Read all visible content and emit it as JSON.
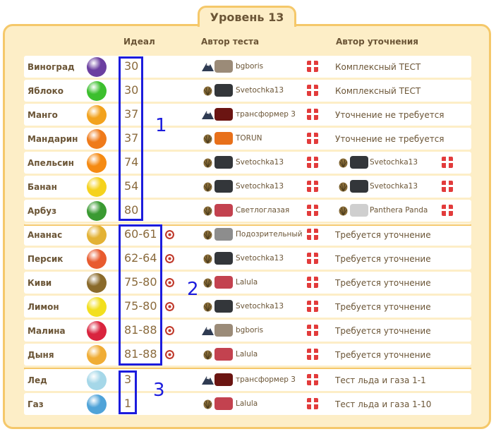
{
  "title": "Уровень 13",
  "headers": {
    "ideal": "Идеал",
    "test_author": "Автор теста",
    "clarify_author": "Автор уточнения"
  },
  "rows": [
    {
      "name": "Виноград",
      "ideal": "30",
      "target": false,
      "author": "bgboris",
      "clar": "Комплексный ТЕСТ",
      "clar_author": "",
      "fruit_color": "#6b3fa0",
      "rank": "mountain",
      "clan": "#9b8b78"
    },
    {
      "name": "Яблоко",
      "ideal": "30",
      "target": false,
      "author": "Svetochka13",
      "clar": "Комплексный ТЕСТ",
      "clar_author": "",
      "fruit_color": "#3cbf2e",
      "rank": "shell",
      "clan": "#33363a"
    },
    {
      "name": "Манго",
      "ideal": "37",
      "target": false,
      "author": "трансформер 3",
      "clar": "Уточнение не требуется",
      "clar_author": "",
      "fruit_color": "#f2a21d",
      "rank": "mountain",
      "clan": "#6b1512"
    },
    {
      "name": "Мандарин",
      "ideal": "37",
      "target": false,
      "author": "TORUN",
      "clar": "Уточнение не требуется",
      "clar_author": "",
      "fruit_color": "#ef7a1a",
      "rank": "shell",
      "clan": "#e8701a"
    },
    {
      "name": "Апельсин",
      "ideal": "74",
      "target": false,
      "author": "Svetochka13",
      "clar": "",
      "clar_author": "Svetochka13",
      "fruit_color": "#f58a12",
      "rank": "shell",
      "clan": "#33363a"
    },
    {
      "name": "Банан",
      "ideal": "54",
      "target": false,
      "author": "Svetochka13",
      "clar": "",
      "clar_author": "Svetochka13",
      "fruit_color": "#f5d21d",
      "rank": "shell",
      "clan": "#33363a"
    },
    {
      "name": "Арбуз",
      "ideal": "80",
      "target": false,
      "author": "Светлоглазая",
      "clar": "",
      "clar_author": "Panthera Panda",
      "fruit_color": "#3a9a32",
      "rank": "shell",
      "clan": "#c3424f"
    },
    {
      "name": "Ананас",
      "ideal": "60-61",
      "target": true,
      "author": "Подозрительный",
      "clar": "Требуется уточнение",
      "clar_author": "",
      "fruit_color": "#e3b234",
      "rank": "shell",
      "clan": "#8d8d8d"
    },
    {
      "name": "Персик",
      "ideal": "62-64",
      "target": true,
      "author": "Svetochka13",
      "clar": "Требуется уточнение",
      "clar_author": "",
      "fruit_color": "#e85b2f",
      "rank": "shell",
      "clan": "#33363a"
    },
    {
      "name": "Киви",
      "ideal": "75-80",
      "target": true,
      "author": "Lalula",
      "clar": "Требуется уточнение",
      "clar_author": "",
      "fruit_color": "#8a6a2a",
      "rank": "shell",
      "clan": "#c3424f"
    },
    {
      "name": "Лимон",
      "ideal": "75-80",
      "target": true,
      "author": "Svetochka13",
      "clar": "Требуется уточнение",
      "clar_author": "",
      "fruit_color": "#f2df1d",
      "rank": "shell",
      "clan": "#33363a"
    },
    {
      "name": "Малина",
      "ideal": "81-88",
      "target": true,
      "author": "bgboris",
      "clar": "Требуется уточнение",
      "clar_author": "",
      "fruit_color": "#d9243e",
      "rank": "mountain",
      "clan": "#9b8b78"
    },
    {
      "name": "Дыня",
      "ideal": "81-88",
      "target": true,
      "author": "Lalula",
      "clar": "Требуется уточнение",
      "clar_author": "",
      "fruit_color": "#f0ad35",
      "rank": "shell",
      "clan": "#c3424f"
    },
    {
      "name": "Лед",
      "ideal": "3",
      "target": false,
      "author": "трансформер 3",
      "clar": "Тест льда и газа 1-1",
      "clar_author": "",
      "fruit_color": "#a5d7e8",
      "rank": "mountain",
      "clan": "#6b1512"
    },
    {
      "name": "Газ",
      "ideal": "1",
      "target": false,
      "author": "Lalula",
      "clar": "Тест льда и газа 1-10",
      "clar_author": "",
      "fruit_color": "#4fa3d8",
      "rank": "shell",
      "clan": "#c3424f"
    }
  ],
  "group_labels": [
    "1",
    "2",
    "3"
  ],
  "colors": {
    "annotation": "#1c1cdd",
    "panel": "#fdeec7",
    "border": "#f5c86a",
    "gift": "#e23b3b"
  }
}
